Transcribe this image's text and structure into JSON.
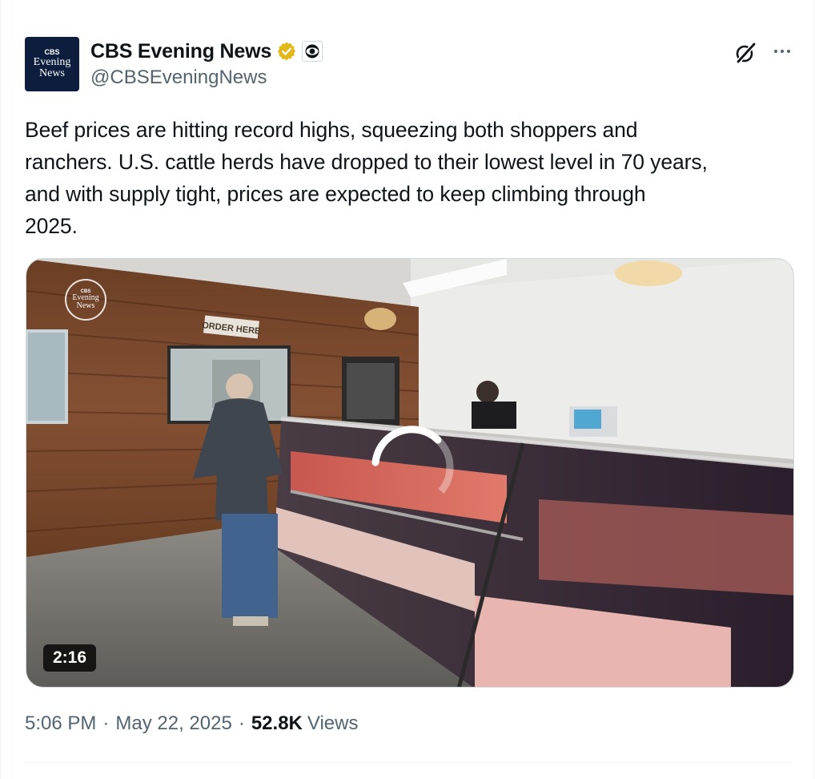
{
  "account": {
    "name": "CBS Evening News",
    "handle": "@CBSEveningNews",
    "avatar_eye": "CBS",
    "avatar_word1": "Evening",
    "avatar_word2": "News",
    "verified_color": "#e2b719",
    "verified_icon": "verified-badge-icon",
    "affiliate_icon": "cbs-eye-icon"
  },
  "actions": {
    "grok_icon": "grok-icon",
    "more_icon": "more-dots-icon"
  },
  "tweet": {
    "text": "Beef prices are hitting record highs, squeezing both shoppers and\nranchers. U.S. cattle herds have dropped to their lowest level in 70 years,\nand with supply tight, prices are expected to keep climbing through\n2025."
  },
  "media": {
    "type": "video",
    "duration": "2:16",
    "watermark_eye": "CBS",
    "watermark_word1": "Evening",
    "watermark_word2": "News",
    "sign_text": "ORDER HERE"
  },
  "meta": {
    "time": "5:06 PM",
    "separator": "·",
    "date": "May 22, 2025",
    "views_count": "52.8K",
    "views_label": "Views"
  }
}
